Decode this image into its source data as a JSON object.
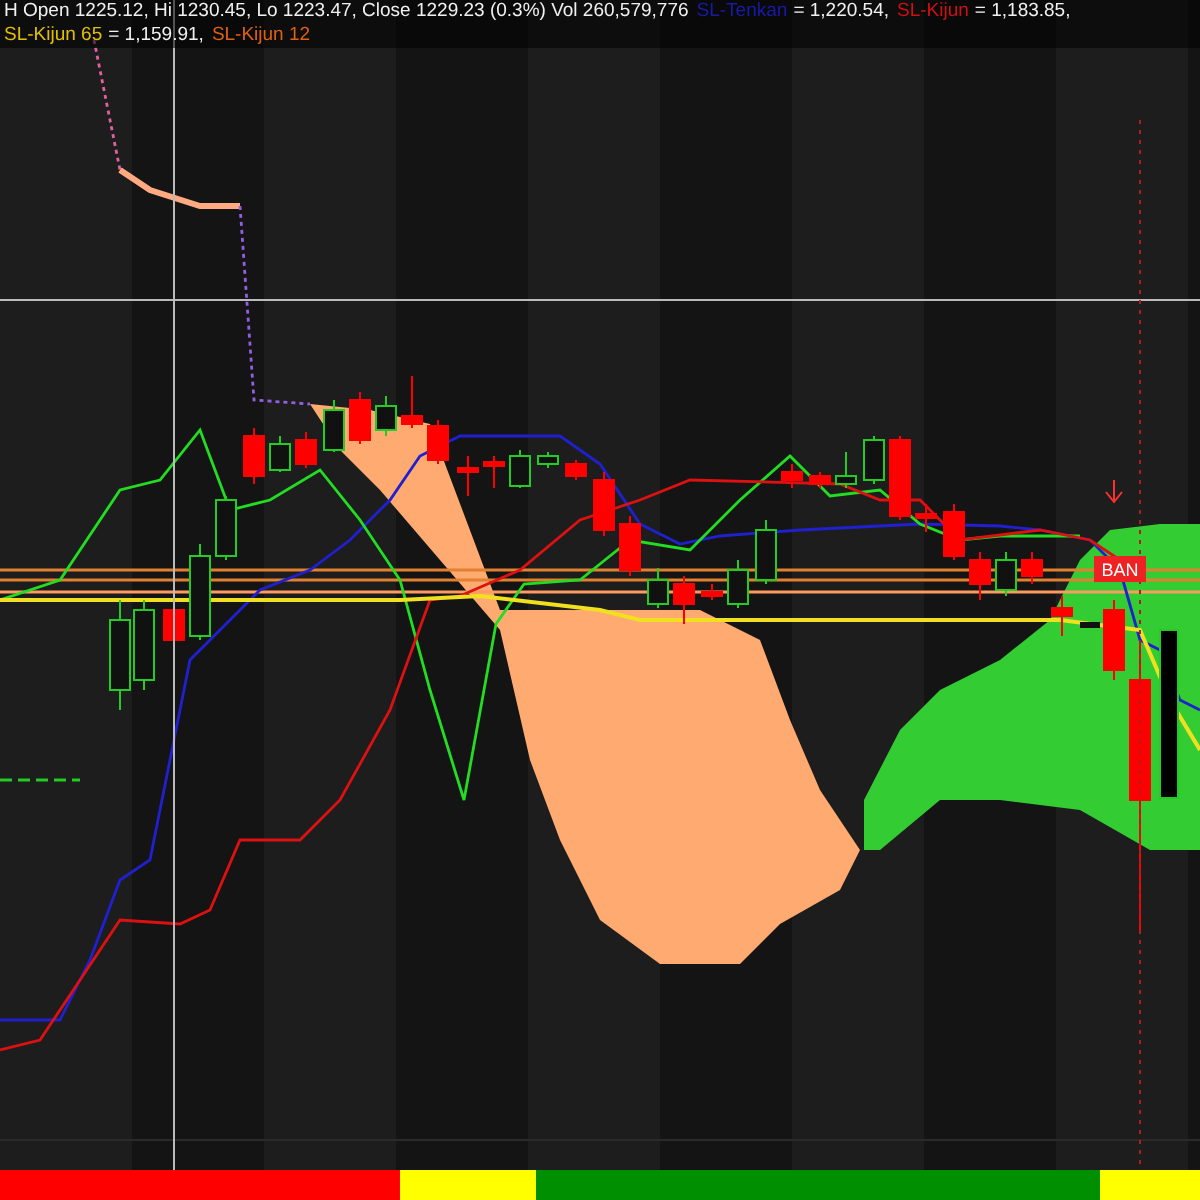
{
  "legend": {
    "ohlc": "H Open 1225.12, Hi 1230.45, Lo 1223.47, Close 1229.23 (0.3%) Vol 260,579,776",
    "indicators": [
      {
        "name": "SL-Tenkan",
        "value": "= 1,220.54,",
        "color": "#1a1aa8"
      },
      {
        "name": "SL-Kijun",
        "value": "= 1,183.85,",
        "color": "#d01010"
      },
      {
        "name": "SL-Kijun 65",
        "value": "= 1,159.91,",
        "color": "#e0c000"
      },
      {
        "name": "SL-Kijun 12",
        "color": "#e06010"
      }
    ]
  },
  "chart": {
    "price_tag": "BAN"
  },
  "signal_bar": [
    {
      "color": "#ff0000"
    },
    {
      "color": "#ffff00"
    },
    {
      "color": "#008f00"
    },
    {
      "color": "#ffff00"
    }
  ]
}
